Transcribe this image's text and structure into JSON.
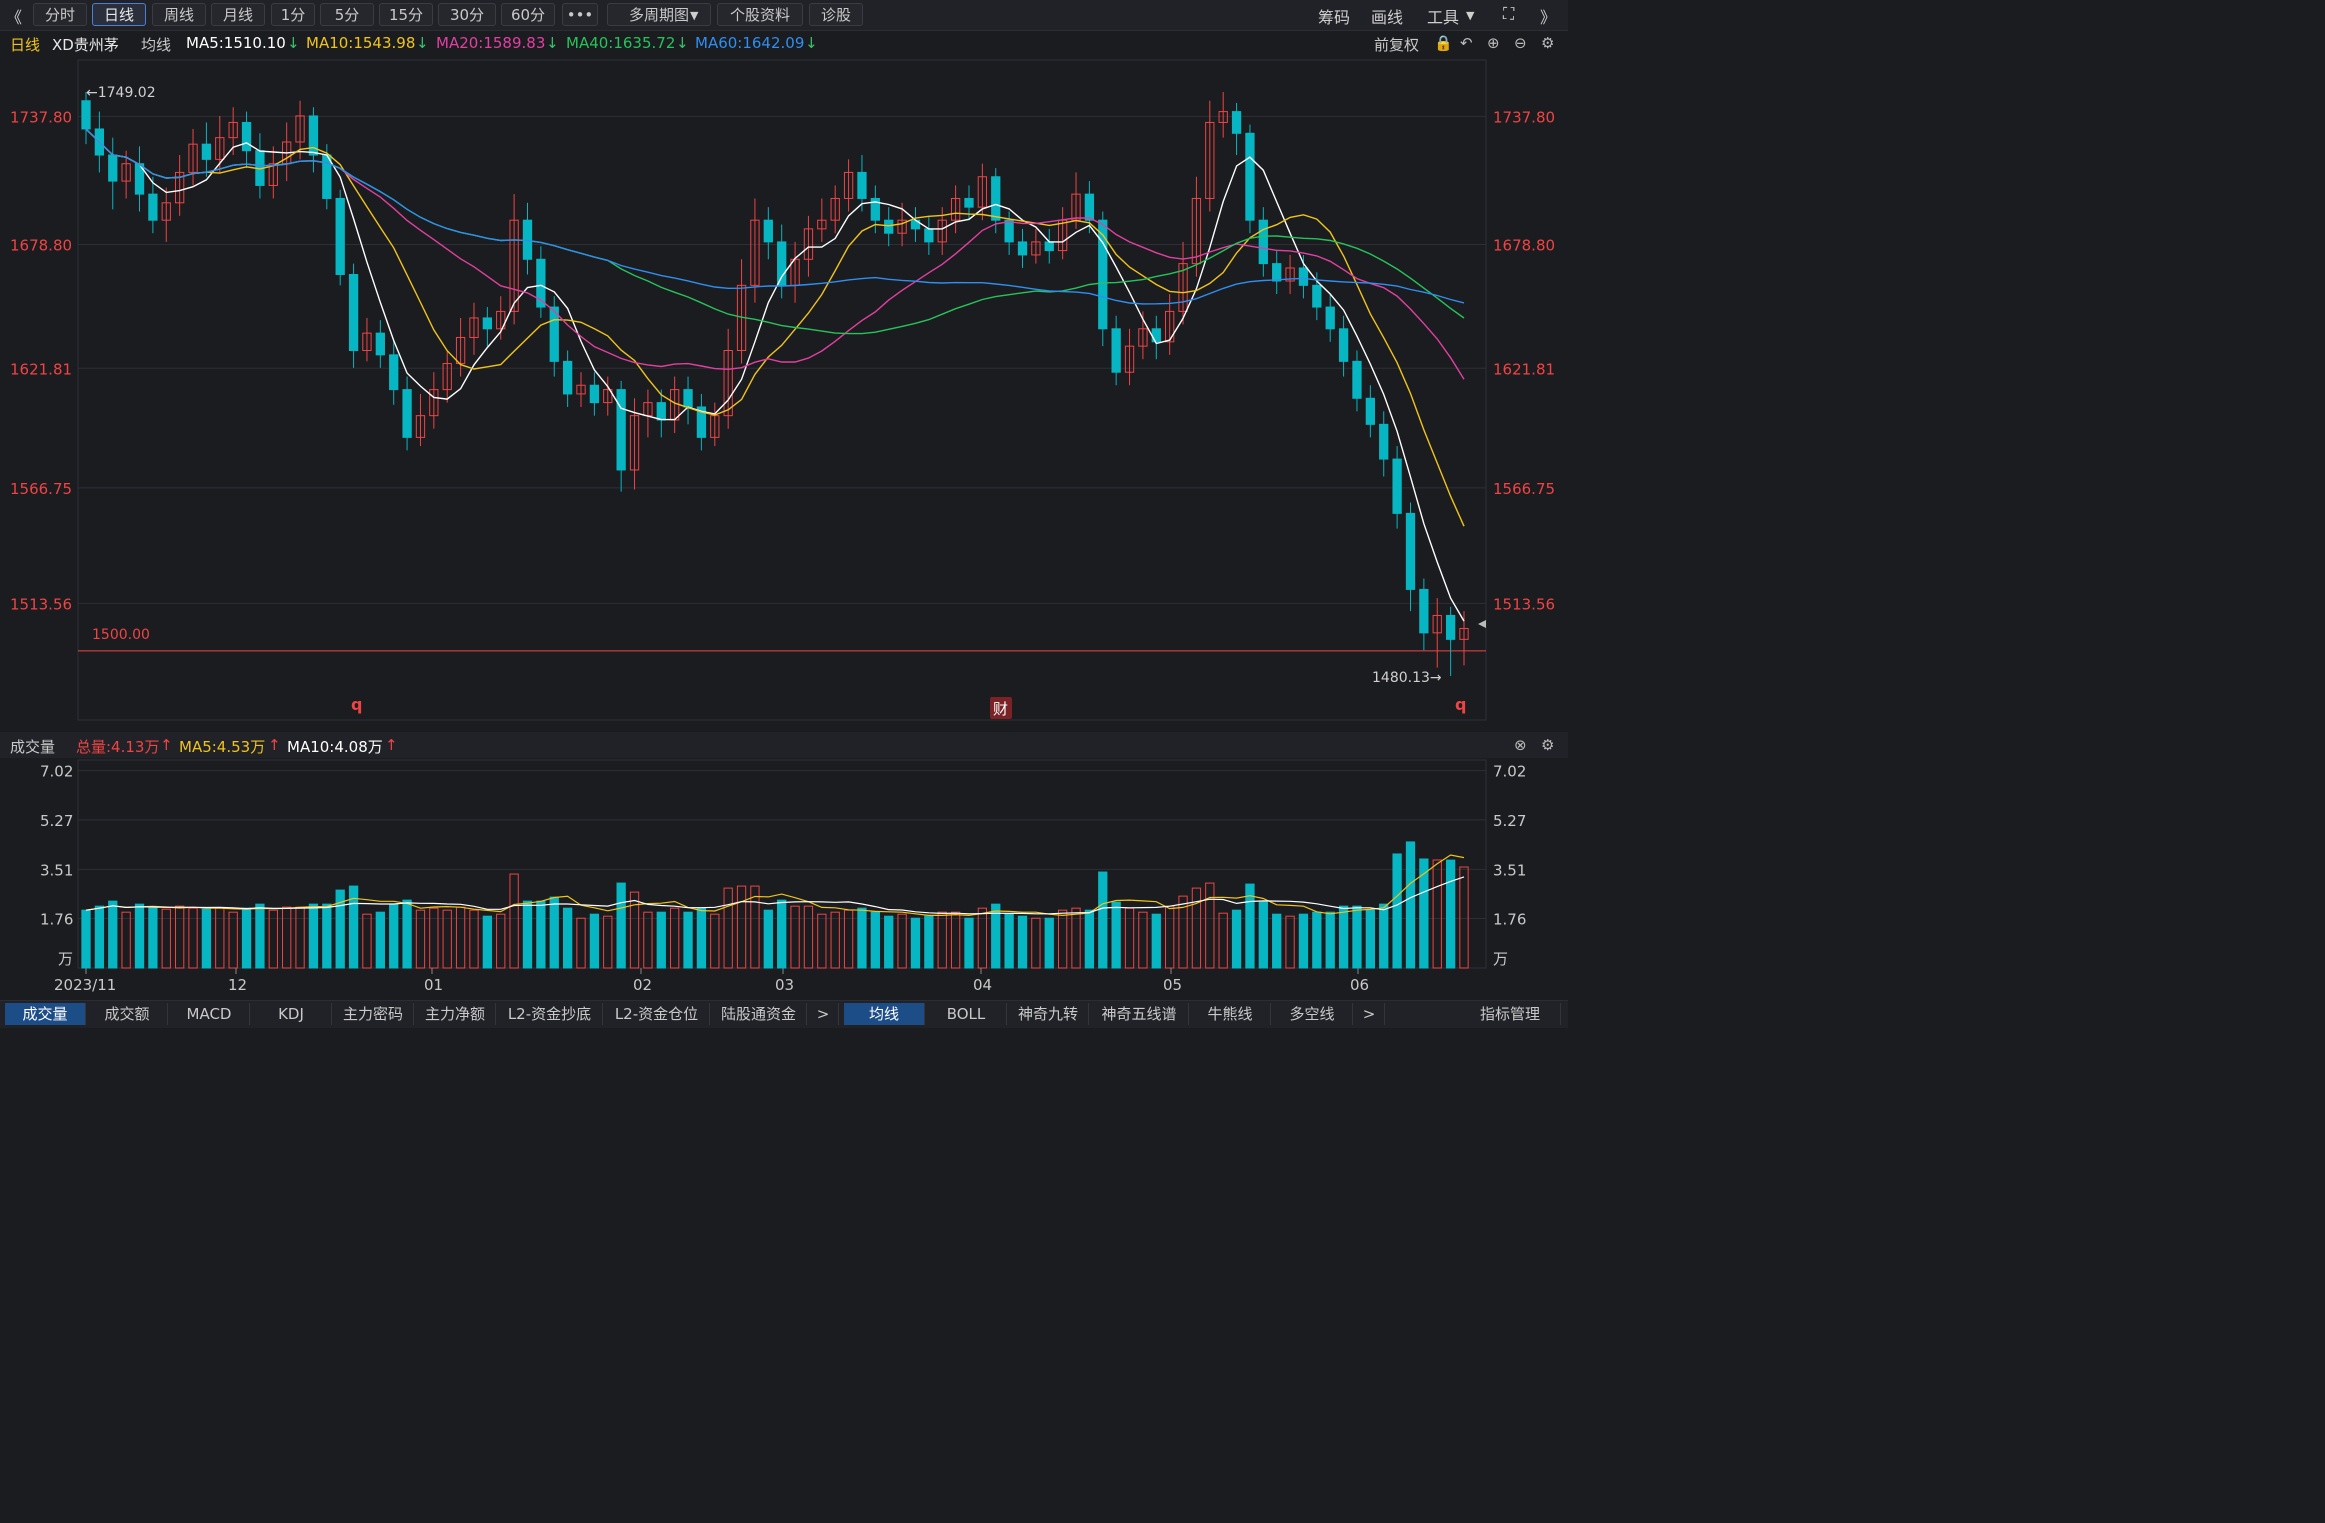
{
  "toolbar": {
    "back": "《",
    "tabs": [
      {
        "label": "分时",
        "active": false
      },
      {
        "label": "日线",
        "active": true
      },
      {
        "label": "周线",
        "active": false
      },
      {
        "label": "月线",
        "active": false
      },
      {
        "label": "1分",
        "active": false
      },
      {
        "label": "5分",
        "active": false
      },
      {
        "label": "15分",
        "active": false
      },
      {
        "label": "30分",
        "active": false
      },
      {
        "label": "60分",
        "active": false
      },
      {
        "label": "•••",
        "active": false
      },
      {
        "label": "多周期图",
        "active": false
      },
      {
        "label": "个股资料",
        "active": false
      },
      {
        "label": "诊股",
        "active": false
      }
    ],
    "right": {
      "chips": "筹码",
      "draw": "画线",
      "tools": "工具",
      "expand": "⛶",
      "forward": "》"
    }
  },
  "info": {
    "period": "日线",
    "stock": "XD贵州茅",
    "ma_label": "均线",
    "ma5": "MA5:1510.10",
    "ma10": "MA10:1543.98",
    "ma20": "MA20:1589.83",
    "ma40": "MA40:1635.72",
    "ma60": "MA60:1642.09",
    "adjust": "前复权"
  },
  "colors": {
    "up": "#ef4444",
    "down": "#06b6c2",
    "ma5": "#ffffff",
    "ma10": "#f0c419",
    "ma20": "#e040a0",
    "ma40": "#27c35a",
    "ma60": "#2f8ef0",
    "price_axis": "#ef4444",
    "ref_line": "#ef4444"
  },
  "price_axis": {
    "ticks": [
      "1737.80",
      "1678.80",
      "1621.81",
      "1566.75",
      "1513.56"
    ]
  },
  "annotations": {
    "high": "←1749.02",
    "low": "1480.13→",
    "ref": "1500.00",
    "marker1": "q",
    "marker2": "财",
    "marker3": "q"
  },
  "volume": {
    "title": "成交量",
    "total": "总量:4.13万",
    "ma5": "MA5:4.53万",
    "ma10": "MA10:4.08万",
    "unit": "万",
    "ticks": [
      "7.02",
      "5.27",
      "3.51",
      "1.76"
    ]
  },
  "date_axis": {
    "labels": [
      "2023/11",
      "12",
      "01",
      "02",
      "03",
      "04",
      "05",
      "06"
    ]
  },
  "bottom_tabs": [
    {
      "label": "成交量",
      "active": true
    },
    {
      "label": "成交额",
      "active": false
    },
    {
      "label": "MACD",
      "active": false
    },
    {
      "label": "KDJ",
      "active": false
    },
    {
      "label": "主力密码",
      "active": false
    },
    {
      "label": "主力净额",
      "active": false
    },
    {
      "label": "L2-资金抄底",
      "active": false
    },
    {
      "label": "L2-资金仓位",
      "active": false
    },
    {
      "label": "陆股通资金",
      "active": false
    },
    {
      "label": ">",
      "active": false
    },
    {
      "label": "均线",
      "active": true
    },
    {
      "label": "BOLL",
      "active": false
    },
    {
      "label": "神奇九转",
      "active": false
    },
    {
      "label": "神奇五线谱",
      "active": false
    },
    {
      "label": "牛熊线",
      "active": false
    },
    {
      "label": "多空线",
      "active": false
    },
    {
      "label": ">",
      "active": false
    },
    {
      "label": "指标管理",
      "active": false
    }
  ],
  "chart_data": {
    "type": "candlestick",
    "y_range": [
      1480.13,
      1749.02
    ],
    "volume_ticks": [
      1.76,
      3.51,
      5.27,
      7.02
    ],
    "candles": [
      [
        1745,
        1732,
        1749,
        1725
      ],
      [
        1732,
        1720,
        1740,
        1712
      ],
      [
        1720,
        1708,
        1728,
        1695
      ],
      [
        1708,
        1716,
        1722,
        1700
      ],
      [
        1716,
        1702,
        1724,
        1694
      ],
      [
        1702,
        1690,
        1710,
        1684
      ],
      [
        1690,
        1698,
        1705,
        1680
      ],
      [
        1698,
        1712,
        1720,
        1692
      ],
      [
        1712,
        1725,
        1732,
        1706
      ],
      [
        1725,
        1718,
        1735,
        1710
      ],
      [
        1718,
        1728,
        1738,
        1712
      ],
      [
        1728,
        1735,
        1742,
        1720
      ],
      [
        1735,
        1722,
        1740,
        1714
      ],
      [
        1722,
        1706,
        1730,
        1700
      ],
      [
        1706,
        1716,
        1724,
        1700
      ],
      [
        1716,
        1726,
        1735,
        1708
      ],
      [
        1726,
        1738,
        1745,
        1718
      ],
      [
        1738,
        1720,
        1742,
        1712
      ],
      [
        1720,
        1700,
        1725,
        1695
      ],
      [
        1700,
        1665,
        1704,
        1660
      ],
      [
        1665,
        1630,
        1670,
        1622
      ],
      [
        1630,
        1638,
        1645,
        1625
      ],
      [
        1638,
        1628,
        1644,
        1622
      ],
      [
        1628,
        1612,
        1635,
        1605
      ],
      [
        1612,
        1590,
        1618,
        1584
      ],
      [
        1590,
        1600,
        1610,
        1586
      ],
      [
        1600,
        1612,
        1620,
        1594
      ],
      [
        1612,
        1624,
        1630,
        1606
      ],
      [
        1624,
        1636,
        1645,
        1618
      ],
      [
        1636,
        1645,
        1652,
        1628
      ],
      [
        1645,
        1640,
        1650,
        1632
      ],
      [
        1640,
        1648,
        1655,
        1635
      ],
      [
        1648,
        1690,
        1702,
        1642
      ],
      [
        1690,
        1672,
        1698,
        1665
      ],
      [
        1672,
        1650,
        1678,
        1645
      ],
      [
        1650,
        1625,
        1655,
        1618
      ],
      [
        1625,
        1610,
        1630,
        1604
      ],
      [
        1610,
        1614,
        1620,
        1604
      ],
      [
        1614,
        1606,
        1620,
        1600
      ],
      [
        1606,
        1612,
        1618,
        1600
      ],
      [
        1612,
        1575,
        1616,
        1565
      ],
      [
        1575,
        1600,
        1608,
        1566
      ],
      [
        1600,
        1606,
        1612,
        1590
      ],
      [
        1606,
        1598,
        1612,
        1590
      ],
      [
        1598,
        1612,
        1618,
        1592
      ],
      [
        1612,
        1604,
        1618,
        1596
      ],
      [
        1604,
        1590,
        1610,
        1584
      ],
      [
        1590,
        1600,
        1606,
        1586
      ],
      [
        1600,
        1630,
        1640,
        1594
      ],
      [
        1630,
        1660,
        1672,
        1624
      ],
      [
        1660,
        1690,
        1700,
        1652
      ],
      [
        1690,
        1680,
        1696,
        1672
      ],
      [
        1680,
        1660,
        1688,
        1654
      ],
      [
        1660,
        1672,
        1680,
        1652
      ],
      [
        1672,
        1686,
        1692,
        1664
      ],
      [
        1686,
        1690,
        1700,
        1680
      ],
      [
        1690,
        1700,
        1706,
        1684
      ],
      [
        1700,
        1712,
        1718,
        1694
      ],
      [
        1712,
        1700,
        1720,
        1694
      ],
      [
        1700,
        1690,
        1706,
        1684
      ],
      [
        1690,
        1684,
        1696,
        1678
      ],
      [
        1684,
        1690,
        1698,
        1678
      ],
      [
        1690,
        1686,
        1696,
        1680
      ],
      [
        1686,
        1680,
        1692,
        1674
      ],
      [
        1680,
        1690,
        1696,
        1674
      ],
      [
        1690,
        1700,
        1706,
        1684
      ],
      [
        1700,
        1696,
        1706,
        1690
      ],
      [
        1696,
        1710,
        1716,
        1690
      ],
      [
        1710,
        1690,
        1714,
        1684
      ],
      [
        1690,
        1680,
        1694,
        1674
      ],
      [
        1680,
        1674,
        1686,
        1668
      ],
      [
        1674,
        1680,
        1686,
        1670
      ],
      [
        1680,
        1676,
        1686,
        1670
      ],
      [
        1676,
        1690,
        1696,
        1672
      ],
      [
        1690,
        1702,
        1712,
        1686
      ],
      [
        1702,
        1690,
        1708,
        1684
      ],
      [
        1690,
        1640,
        1694,
        1632
      ],
      [
        1640,
        1620,
        1646,
        1614
      ],
      [
        1620,
        1632,
        1640,
        1614
      ],
      [
        1632,
        1640,
        1648,
        1626
      ],
      [
        1640,
        1634,
        1646,
        1626
      ],
      [
        1634,
        1648,
        1656,
        1628
      ],
      [
        1648,
        1670,
        1680,
        1642
      ],
      [
        1670,
        1700,
        1710,
        1664
      ],
      [
        1700,
        1735,
        1745,
        1694
      ],
      [
        1735,
        1740,
        1749,
        1728
      ],
      [
        1740,
        1730,
        1744,
        1720
      ],
      [
        1730,
        1690,
        1734,
        1684
      ],
      [
        1690,
        1670,
        1696,
        1664
      ],
      [
        1670,
        1662,
        1676,
        1656
      ],
      [
        1662,
        1668,
        1674,
        1656
      ],
      [
        1668,
        1660,
        1674,
        1654
      ],
      [
        1660,
        1650,
        1666,
        1644
      ],
      [
        1650,
        1640,
        1656,
        1634
      ],
      [
        1640,
        1625,
        1646,
        1618
      ],
      [
        1625,
        1608,
        1630,
        1602
      ],
      [
        1608,
        1596,
        1614,
        1590
      ],
      [
        1596,
        1580,
        1602,
        1572
      ],
      [
        1580,
        1555,
        1586,
        1548
      ],
      [
        1555,
        1520,
        1560,
        1510
      ],
      [
        1520,
        1500,
        1525,
        1492
      ],
      [
        1500,
        1508,
        1516,
        1484
      ],
      [
        1508,
        1497,
        1512,
        1480.13
      ],
      [
        1497,
        1502,
        1510,
        1485
      ]
    ]
  }
}
